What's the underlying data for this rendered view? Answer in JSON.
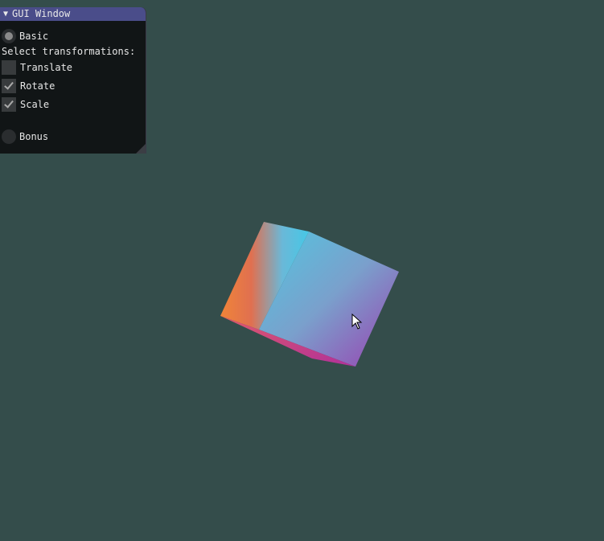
{
  "window": {
    "title": "GUI Window",
    "collapse_icon": "triangle-down-icon"
  },
  "options": {
    "basic_label": "Basic",
    "basic_selected": true,
    "select_label": "Select transformations:",
    "translate_label": "Translate",
    "translate_checked": false,
    "rotate_label": "Rotate",
    "rotate_checked": true,
    "scale_label": "Scale",
    "scale_checked": true,
    "bonus_label": "Bonus",
    "bonus_selected": false
  },
  "scene": {
    "background_color": "#344d4b",
    "object": "rotating-cube",
    "face_colors": [
      "#f07a3a",
      "#46c8e6",
      "#8a5fb0",
      "#c832a0"
    ]
  }
}
